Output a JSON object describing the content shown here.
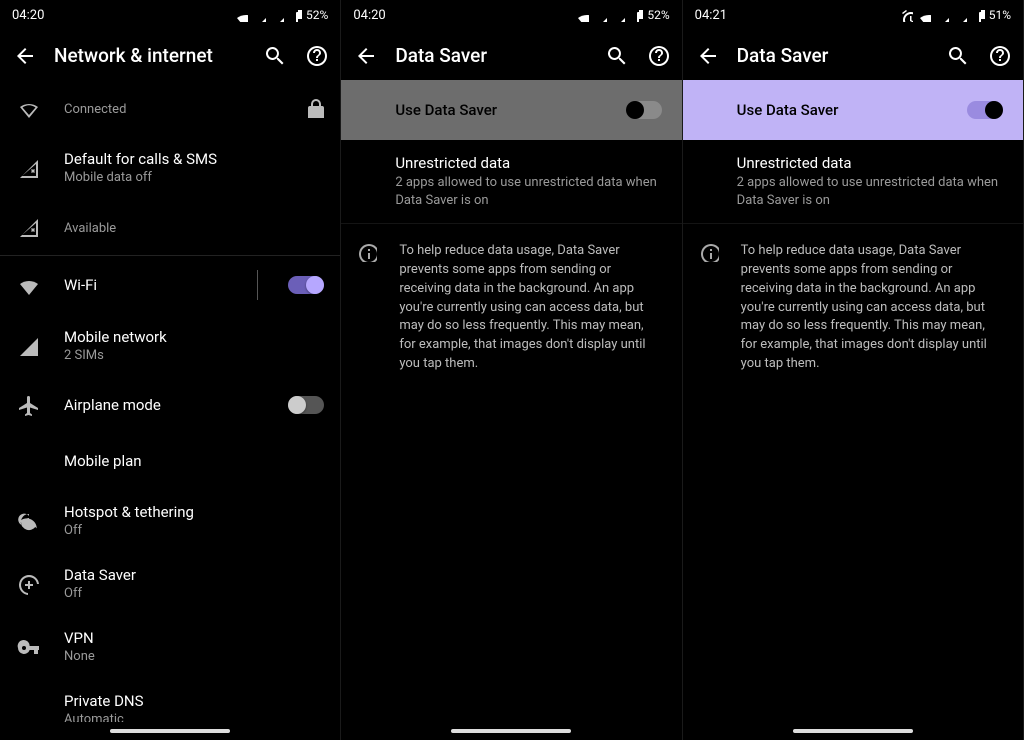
{
  "panel1": {
    "status": {
      "time": "04:20",
      "battery": "52%"
    },
    "title": "Network & internet",
    "topitems": [
      {
        "icon": "wifi-empty",
        "primary": "",
        "secondary": "Connected",
        "lock": true
      },
      {
        "icon": "signal-x",
        "primary": "Default for calls & SMS",
        "secondary": "Mobile data off"
      },
      {
        "icon": "signal-x",
        "primary": "",
        "secondary": "Available"
      }
    ],
    "items": [
      {
        "icon": "wifi-full",
        "primary": "Wi-Fi",
        "secondary": "",
        "toggle": "on-purple",
        "dividerBefore": true
      },
      {
        "icon": "signal-full",
        "primary": "Mobile network",
        "secondary": "2 SIMs"
      },
      {
        "icon": "airplane",
        "primary": "Airplane mode",
        "secondary": "",
        "toggle": "off"
      },
      {
        "icon": "",
        "primary": "Mobile plan",
        "secondary": ""
      },
      {
        "icon": "hotspot",
        "primary": "Hotspot & tethering",
        "secondary": "Off"
      },
      {
        "icon": "datasaver",
        "primary": "Data Saver",
        "secondary": "Off"
      },
      {
        "icon": "vpn",
        "primary": "VPN",
        "secondary": "None"
      },
      {
        "icon": "",
        "primary": "Private DNS",
        "secondary": "Automatic"
      }
    ]
  },
  "panel2": {
    "status": {
      "time": "04:20",
      "battery": "52%"
    },
    "title": "Data Saver",
    "main_toggle_label": "Use Data Saver",
    "main_toggle_state": "gray",
    "unrestricted_title": "Unrestricted data",
    "unrestricted_sub": "2 apps allowed to use unrestricted data when Data Saver is on",
    "info_text": "To help reduce data usage, Data Saver prevents some apps from sending or receiving data in the background. An app you're currently using can access data, but may do so less frequently. This may mean, for example, that images don't display until you tap them."
  },
  "panel3": {
    "status": {
      "time": "04:21",
      "battery": "51%",
      "alarm": true
    },
    "title": "Data Saver",
    "main_toggle_label": "Use Data Saver",
    "main_toggle_state": "purple",
    "unrestricted_title": "Unrestricted data",
    "unrestricted_sub": "2 apps allowed to use unrestricted data when Data Saver is on",
    "info_text": "To help reduce data usage, Data Saver prevents some apps from sending or receiving data in the background. An app you're currently using can access data, but may do so less frequently. This may mean, for example, that images don't display until you tap them."
  }
}
